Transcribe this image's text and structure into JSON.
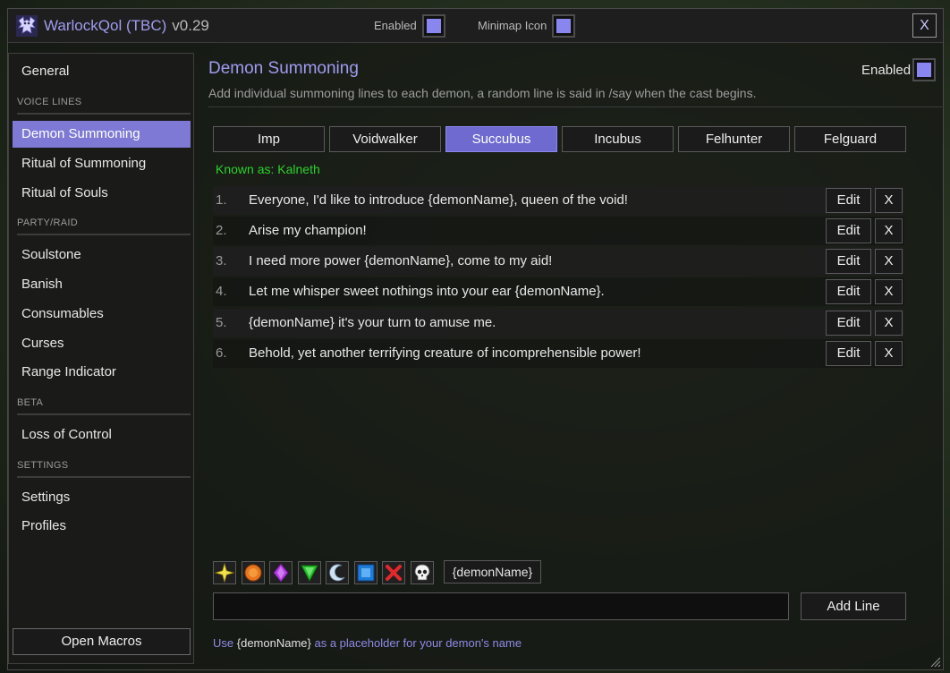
{
  "app": {
    "name": "WarlockQol (TBC)",
    "version": "v0.29",
    "enabled_label": "Enabled",
    "minimap_label": "Minimap Icon",
    "close_label": "X",
    "accent_color": "#8a86f0"
  },
  "sidebar": {
    "items": [
      {
        "label": "General"
      },
      {
        "section": "VOICE LINES"
      },
      {
        "label": "Demon Summoning",
        "active": true
      },
      {
        "label": "Ritual of Summoning"
      },
      {
        "label": "Ritual of Souls"
      },
      {
        "section": "PARTY/RAID"
      },
      {
        "label": "Soulstone"
      },
      {
        "label": "Banish"
      },
      {
        "label": "Consumables"
      },
      {
        "label": "Curses"
      },
      {
        "label": "Range Indicator"
      },
      {
        "section": "BETA"
      },
      {
        "label": "Loss of Control"
      },
      {
        "section": "SETTINGS"
      },
      {
        "label": "Settings"
      },
      {
        "label": "Profiles"
      }
    ],
    "footer_button": "Open Macros"
  },
  "main": {
    "title": "Demon Summoning",
    "description": "Add individual summoning lines to each demon, a random line is said in /say when the cast begins.",
    "enabled_label": "Enabled",
    "tabs": [
      {
        "label": "Imp"
      },
      {
        "label": "Voidwalker"
      },
      {
        "label": "Succubus",
        "active": true
      },
      {
        "label": "Incubus"
      },
      {
        "label": "Felhunter"
      },
      {
        "label": "Felguard"
      }
    ],
    "known_as": "Known as: Kalneth",
    "lines": [
      {
        "num": "1.",
        "text": "Everyone, I'd like to introduce {demonName}, queen of the void!"
      },
      {
        "num": "2.",
        "text": "Arise my champion!"
      },
      {
        "num": "3.",
        "text": "I need more power {demonName}, come to my aid!"
      },
      {
        "num": "4.",
        "text": "Let me whisper sweet nothings into your ear {demonName}."
      },
      {
        "num": "5.",
        "text": "{demonName} it's your turn to amuse me."
      },
      {
        "num": "6.",
        "text": "Behold, yet another terrifying creature of incomprehensible power!"
      }
    ],
    "edit_label": "Edit",
    "delete_label": "X",
    "raid_icons": [
      "star-icon",
      "circle-icon",
      "diamond-icon",
      "triangle-icon",
      "moon-icon",
      "square-icon",
      "cross-icon",
      "skull-icon"
    ],
    "placeholder_chip": "{demonName}",
    "input_value": "",
    "add_button": "Add Line",
    "hint_prefix": "Use",
    "hint_placeholder": "{demonName}",
    "hint_suffix": "as a placeholder for your demon's name"
  }
}
